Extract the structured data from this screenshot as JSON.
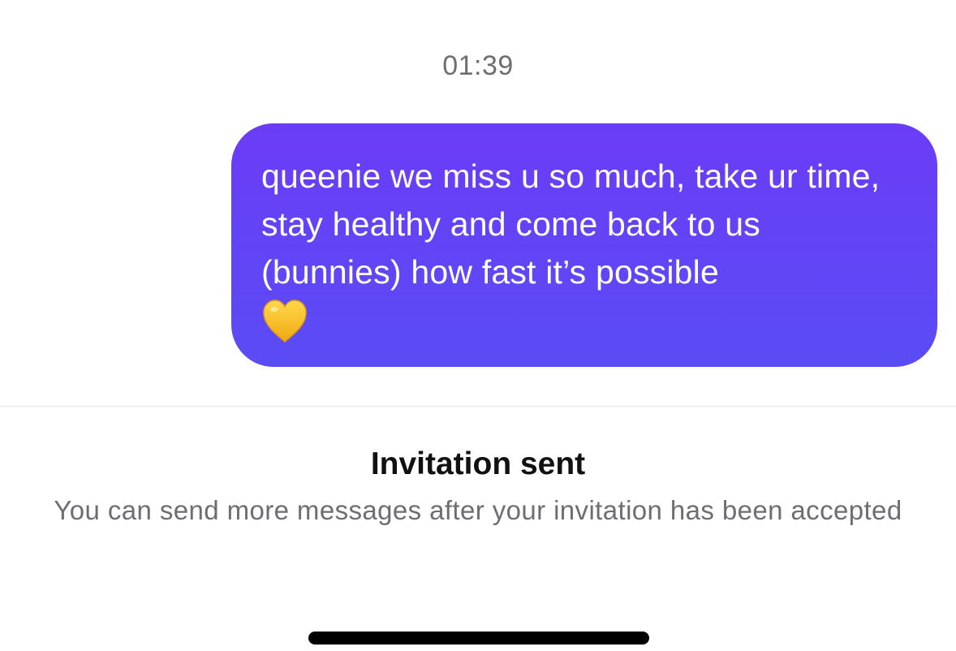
{
  "conversation": {
    "timestamp": "01:39",
    "message": {
      "text": "queenie we miss u so much, take ur time, stay healthy and come back to us (bunnies) how fast it’s possible",
      "emoji": "yellow-heart-icon"
    }
  },
  "invitation": {
    "title": "Invitation sent",
    "subtitle": "You can send more messages after your invitation has been accepted"
  },
  "colors": {
    "bubble_top": "#6b3cf6",
    "bubble_bottom": "#5a4cf5",
    "muted_text": "#6d6d72",
    "heart": "#f7c52a"
  }
}
